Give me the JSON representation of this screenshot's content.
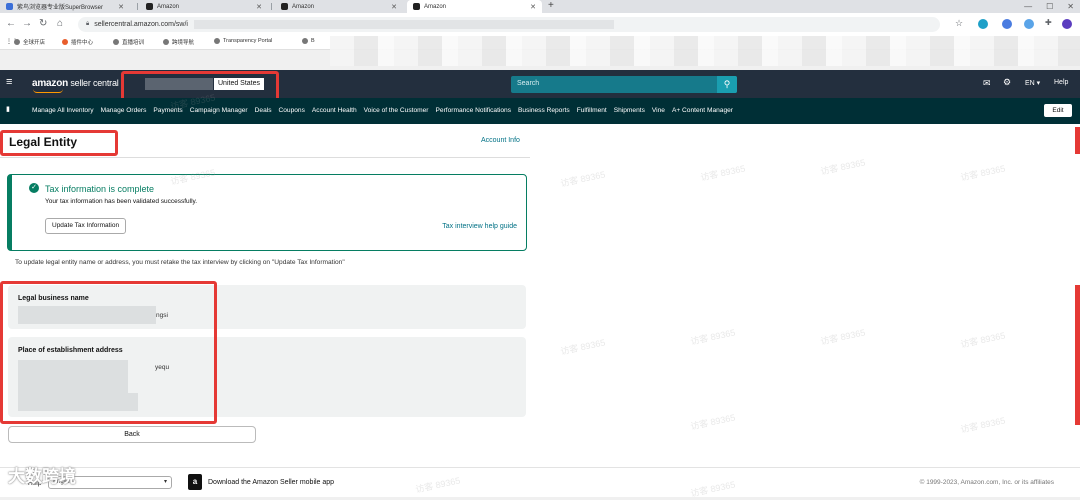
{
  "browser": {
    "tabs": [
      {
        "title": "紫鸟浏览器专业版SuperBrowser"
      },
      {
        "title": "Amazon"
      },
      {
        "title": "Amazon"
      },
      {
        "title": "Amazon"
      }
    ],
    "url": "sellercentral.amazon.com/sw/i",
    "bookmarks": [
      "全球开店",
      "插件中心",
      "直播培训",
      "跨境导航",
      "Transparency Portal",
      "B"
    ],
    "apps_label": "⋮⋮"
  },
  "header": {
    "logo_text": "amazon",
    "logo_sub": " seller central",
    "country": "United States",
    "search_placeholder": "Search",
    "lang": "EN ▾",
    "help": "Help"
  },
  "nav": {
    "items": [
      "Manage All Inventory",
      "Manage Orders",
      "Payments",
      "Campaign Manager",
      "Deals",
      "Coupons",
      "Account Health",
      "Voice of the Customer",
      "Performance Notifications",
      "Business Reports",
      "Fulfillment",
      "Shipments",
      "Vine",
      "A+ Content Manager"
    ],
    "edit": "Edit"
  },
  "page": {
    "title": "Legal Entity",
    "account_info": "Account Info",
    "tax": {
      "title": "Tax information is complete",
      "desc": "Your tax information has been validated successfully.",
      "update_button": "Update Tax Information",
      "guide_link": "Tax interview help guide"
    },
    "instruction": "To update legal entity name or address, you must retake the tax interview by clicking on \"Update Tax Information\"",
    "business_name": {
      "label": "Legal business name",
      "value_fragment": "ngsi"
    },
    "address": {
      "label": "Place of establishment address",
      "value_fragment": "yequ"
    },
    "back": "Back"
  },
  "footer": {
    "help": "Help",
    "language": "English",
    "download": "Download the Amazon Seller mobile app",
    "copyright": "© 1999-2023, Amazon.com, Inc. or its affiliates"
  },
  "watermark": {
    "text": "访客 89365",
    "corner": "大数跨境"
  },
  "colors": {
    "header": "#232f3e",
    "nav": "#002f36",
    "success": "#067d62",
    "link": "#007185",
    "search": "#167a8b",
    "highlight": "#e53935"
  }
}
